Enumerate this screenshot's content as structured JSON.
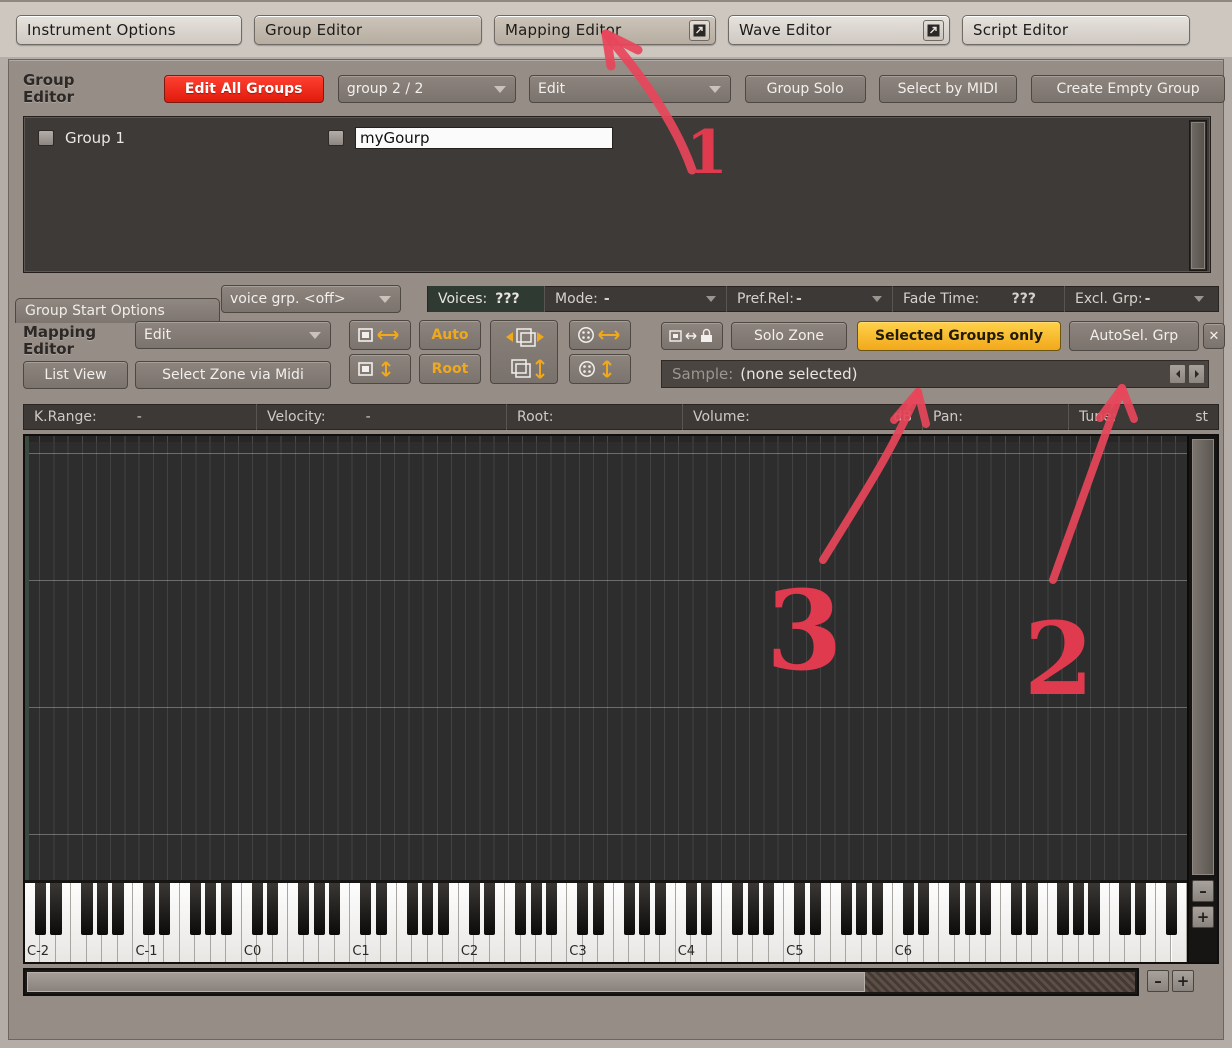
{
  "tabs": [
    {
      "label": "Instrument Options",
      "active": false,
      "detach": false
    },
    {
      "label": "Group Editor",
      "active": true,
      "detach": false
    },
    {
      "label": "Mapping Editor",
      "active": true,
      "detach": true
    },
    {
      "label": "Wave Editor",
      "active": false,
      "detach": true
    },
    {
      "label": "Script Editor",
      "active": false,
      "detach": false
    }
  ],
  "group_editor": {
    "title_line1": "Group",
    "title_line2": "Editor",
    "edit_all_groups": "Edit All Groups",
    "group_selector": "group 2 / 2",
    "edit_menu": "Edit",
    "group_solo": "Group Solo",
    "select_by_midi": "Select by MIDI",
    "create_empty_group": "Create Empty Group",
    "groups": [
      {
        "name": "Group 1",
        "checked": false,
        "editing": false
      },
      {
        "name": "myGourp",
        "checked": false,
        "editing": true
      }
    ]
  },
  "voice_bar": {
    "group_start_options": "Group Start Options",
    "voice_group": "voice grp. <off>",
    "voices_label": "Voices:",
    "voices_value": "???",
    "mode_label": "Mode:",
    "mode_value": "-",
    "pref_rel_label": "Pref.Rel:",
    "pref_rel_value": "-",
    "fade_time_label": "Fade Time:",
    "fade_time_value": "???",
    "excl_grp_label": "Excl. Grp:",
    "excl_grp_value": "-"
  },
  "mapping_editor": {
    "title_line1": "Mapping",
    "title_line2": "Editor",
    "edit_menu": "Edit",
    "list_view": "List View",
    "select_zone_via_midi": "Select Zone via Midi",
    "auto_button": "Auto",
    "root_button": "Root",
    "solo_zone": "Solo Zone",
    "selected_groups_only": "Selected Groups only",
    "auto_sel_grp": "AutoSel. Grp",
    "sample_label": "Sample:",
    "sample_value": "(none selected)",
    "icon_buttons": [
      {
        "name": "zone-width-horizontal-icon",
        "row": 1
      },
      {
        "name": "zone-height-vertical-icon",
        "row": 2
      },
      {
        "name": "move-zone-horizontal-icon",
        "row": 1
      },
      {
        "name": "move-zone-vertical-icon",
        "row": 2
      },
      {
        "name": "velocity-crossfade-horizontal-icon",
        "row": 1
      },
      {
        "name": "velocity-crossfade-vertical-icon",
        "row": 2
      },
      {
        "name": "zone-lock-icon",
        "row": 1
      }
    ]
  },
  "zone_info": {
    "krange_label": "K.Range:",
    "krange_value": "-",
    "velocity_label": "Velocity:",
    "velocity_value": "-",
    "root_label": "Root:",
    "root_value": "",
    "volume_label": "Volume:",
    "volume_unit": "dB",
    "pan_label": "Pan:",
    "pan_value": "",
    "tune_label": "Tune:",
    "tune_unit": "st"
  },
  "keyboard": {
    "octave_labels": [
      "C-2",
      "C-1",
      "C0",
      "C1",
      "C2",
      "C3",
      "C4",
      "C5",
      "C6"
    ],
    "white_key_count": 75
  },
  "controls": {
    "zoom_out": "–",
    "zoom_in": "+",
    "nav_prev": "◀",
    "nav_next": "▶",
    "close": "✕"
  },
  "annotations": [
    {
      "label": "1",
      "target": "Mapping Editor tab"
    },
    {
      "label": "2",
      "target": "AutoSel. Grp"
    },
    {
      "label": "3",
      "target": "Selected Groups only"
    }
  ],
  "colors": {
    "accent_red": "#e01b0c",
    "accent_amber": "#f2a81b",
    "annotation": "#e03a4e",
    "panel_bg": "#968d87",
    "grid_bg": "#2d2d2d"
  }
}
